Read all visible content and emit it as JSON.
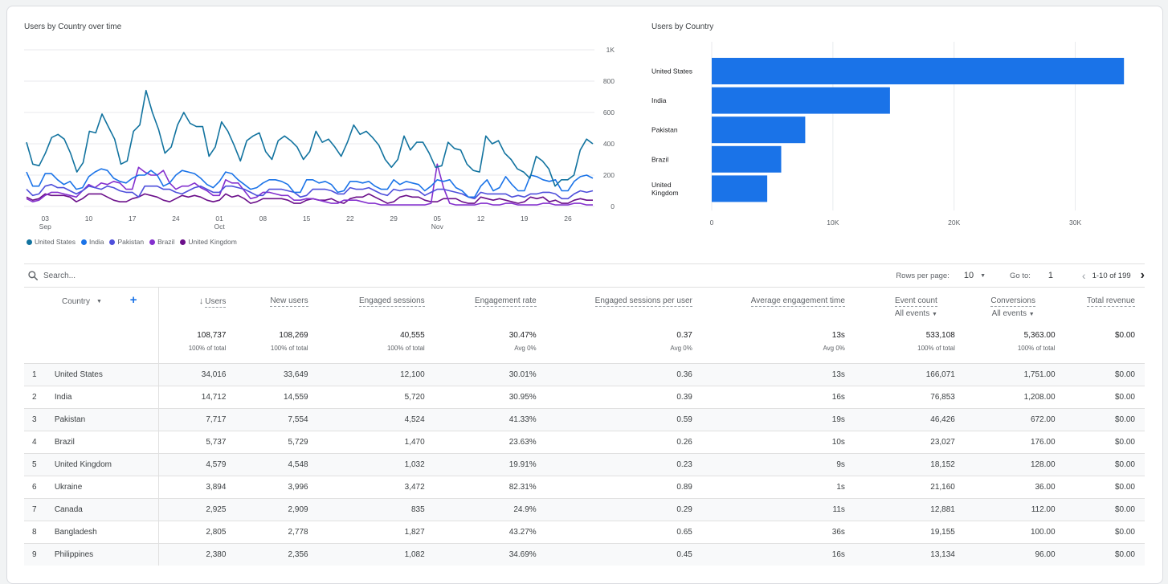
{
  "line_chart_title": "Users by Country over time",
  "bar_chart_title": "Users by Country",
  "chart_data": [
    {
      "type": "line",
      "title": "Users by Country over time",
      "xlabel": "",
      "ylabel": "",
      "ylim": [
        0,
        1000
      ],
      "y_ticks": [
        "0",
        "200",
        "400",
        "600",
        "800",
        "1K"
      ],
      "y_axis_side": "right",
      "x_ticks": [
        {
          "label": "03",
          "sub": "Sep",
          "day": 3
        },
        {
          "label": "10",
          "sub": "",
          "day": 10
        },
        {
          "label": "17",
          "sub": "",
          "day": 17
        },
        {
          "label": "24",
          "sub": "",
          "day": 24
        },
        {
          "label": "01",
          "sub": "Oct",
          "day": 31
        },
        {
          "label": "08",
          "sub": "",
          "day": 38
        },
        {
          "label": "15",
          "sub": "",
          "day": 45
        },
        {
          "label": "22",
          "sub": "",
          "day": 52
        },
        {
          "label": "29",
          "sub": "",
          "day": 59
        },
        {
          "label": "05",
          "sub": "Nov",
          "day": 66
        },
        {
          "label": "12",
          "sub": "",
          "day": 73
        },
        {
          "label": "19",
          "sub": "",
          "day": 80
        },
        {
          "label": "26",
          "sub": "",
          "day": 87
        }
      ],
      "x_start_day": 0,
      "x_end_day": 91,
      "grid": true,
      "legend_position": "bottom-left",
      "series": [
        {
          "name": "United States",
          "color": "#12739f",
          "values": [
            410,
            270,
            260,
            340,
            440,
            460,
            430,
            340,
            220,
            280,
            480,
            470,
            590,
            510,
            430,
            270,
            290,
            480,
            520,
            740,
            600,
            490,
            340,
            380,
            520,
            600,
            530,
            510,
            510,
            320,
            380,
            540,
            480,
            390,
            290,
            420,
            450,
            470,
            350,
            300,
            420,
            450,
            420,
            380,
            300,
            350,
            480,
            410,
            430,
            380,
            320,
            410,
            520,
            460,
            480,
            440,
            390,
            300,
            250,
            300,
            450,
            360,
            410,
            410,
            340,
            250,
            260,
            410,
            370,
            360,
            270,
            230,
            220,
            450,
            400,
            420,
            340,
            300,
            240,
            220,
            180,
            320,
            290,
            240,
            130,
            170,
            170,
            200,
            360,
            430,
            400
          ]
        },
        {
          "name": "India",
          "color": "#1a73e8",
          "values": [
            220,
            130,
            130,
            210,
            210,
            170,
            140,
            160,
            110,
            120,
            190,
            220,
            240,
            230,
            180,
            160,
            150,
            180,
            200,
            200,
            230,
            200,
            130,
            150,
            200,
            230,
            220,
            210,
            180,
            140,
            120,
            160,
            220,
            210,
            170,
            140,
            110,
            120,
            150,
            170,
            170,
            160,
            140,
            90,
            90,
            170,
            170,
            150,
            160,
            140,
            90,
            100,
            160,
            160,
            150,
            160,
            130,
            110,
            110,
            170,
            140,
            160,
            150,
            140,
            100,
            130,
            170,
            160,
            170,
            120,
            100,
            60,
            60,
            130,
            170,
            100,
            120,
            190,
            140,
            100,
            100,
            200,
            190,
            170,
            160,
            170,
            100,
            100,
            160,
            190,
            200,
            180
          ]
        },
        {
          "name": "Pakistan",
          "color": "#4e4fdb",
          "values": [
            110,
            70,
            80,
            130,
            140,
            120,
            120,
            100,
            80,
            100,
            130,
            120,
            110,
            130,
            120,
            100,
            90,
            90,
            60,
            130,
            130,
            130,
            110,
            110,
            90,
            80,
            100,
            120,
            130,
            110,
            90,
            90,
            130,
            130,
            120,
            110,
            90,
            70,
            70,
            110,
            110,
            110,
            100,
            90,
            60,
            70,
            110,
            110,
            110,
            100,
            80,
            80,
            120,
            110,
            110,
            120,
            100,
            80,
            70,
            110,
            100,
            110,
            110,
            100,
            70,
            90,
            110,
            110,
            100,
            90,
            80,
            60,
            50,
            90,
            80,
            80,
            80,
            80,
            60,
            70,
            60,
            80,
            80,
            90,
            90,
            80,
            50,
            50,
            80,
            100,
            90,
            100
          ]
        },
        {
          "name": "Brazil",
          "color": "#8430ce",
          "values": [
            50,
            30,
            40,
            70,
            90,
            90,
            80,
            70,
            60,
            100,
            140,
            120,
            150,
            140,
            160,
            150,
            110,
            110,
            250,
            220,
            200,
            200,
            230,
            150,
            110,
            130,
            130,
            150,
            120,
            100,
            70,
            70,
            170,
            150,
            150,
            100,
            50,
            60,
            90,
            90,
            80,
            70,
            70,
            40,
            40,
            50,
            50,
            40,
            30,
            20,
            20,
            40,
            40,
            40,
            30,
            20,
            20,
            10,
            10,
            10,
            10,
            10,
            10,
            10,
            10,
            20,
            270,
            120,
            20,
            10,
            10,
            10,
            10,
            20,
            20,
            10,
            10,
            20,
            20,
            10,
            10,
            10,
            10,
            20,
            20,
            10,
            10,
            10,
            20,
            20,
            10,
            10
          ]
        },
        {
          "name": "United Kingdom",
          "color": "#6b0f8a",
          "values": [
            60,
            40,
            50,
            80,
            70,
            70,
            70,
            60,
            30,
            50,
            80,
            80,
            80,
            60,
            40,
            30,
            30,
            50,
            60,
            80,
            70,
            60,
            40,
            30,
            50,
            70,
            60,
            70,
            60,
            40,
            30,
            40,
            80,
            60,
            70,
            50,
            20,
            30,
            50,
            50,
            50,
            50,
            40,
            20,
            20,
            40,
            50,
            40,
            40,
            50,
            30,
            20,
            50,
            60,
            60,
            80,
            60,
            40,
            20,
            30,
            60,
            70,
            60,
            60,
            40,
            30,
            30,
            50,
            50,
            50,
            30,
            20,
            20,
            60,
            50,
            40,
            50,
            40,
            30,
            20,
            30,
            60,
            50,
            60,
            30,
            40,
            20,
            20,
            40,
            50,
            40,
            40
          ]
        }
      ]
    },
    {
      "type": "bar",
      "orientation": "horizontal",
      "title": "Users by Country",
      "categories": [
        "United States",
        "India",
        "Pakistan",
        "Brazil",
        "United Kingdom"
      ],
      "category_lines": [
        [
          "United States"
        ],
        [
          "India"
        ],
        [
          "Pakistan"
        ],
        [
          "Brazil"
        ],
        [
          "United",
          "Kingdom"
        ]
      ],
      "values": [
        34016,
        14712,
        7717,
        5737,
        4579
      ],
      "color": "#1a73e8",
      "xlim": [
        0,
        35000
      ],
      "x_ticks": [
        {
          "value": 0,
          "label": "0"
        },
        {
          "value": 10000,
          "label": "10K"
        },
        {
          "value": 20000,
          "label": "20K"
        },
        {
          "value": 30000,
          "label": "30K"
        }
      ],
      "grid": true
    }
  ],
  "toolbar": {
    "search_placeholder": "Search...",
    "rows_per_page_label": "Rows per page:",
    "rows_per_page_value": "10",
    "goto_label": "Go to:",
    "goto_value": "1",
    "page_range": "1-10 of 199"
  },
  "table": {
    "dimension_header": "Country",
    "columns": [
      {
        "label": "Users",
        "sorted_desc": true,
        "sub": ""
      },
      {
        "label": "New users",
        "sub": ""
      },
      {
        "label": "Engaged sessions",
        "sub": ""
      },
      {
        "label": "Engagement rate",
        "sub": ""
      },
      {
        "label": "Engaged sessions per user",
        "sub": ""
      },
      {
        "label": "Average engagement time",
        "sub": ""
      },
      {
        "label": "Event count",
        "sub": "All events"
      },
      {
        "label": "Conversions",
        "sub": "All events"
      },
      {
        "label": "Total revenue",
        "sub": ""
      }
    ],
    "totals": [
      {
        "value": "108,737",
        "sub": "100% of total"
      },
      {
        "value": "108,269",
        "sub": "100% of total"
      },
      {
        "value": "40,555",
        "sub": "100% of total"
      },
      {
        "value": "30.47%",
        "sub": "Avg 0%"
      },
      {
        "value": "0.37",
        "sub": "Avg 0%"
      },
      {
        "value": "13s",
        "sub": "Avg 0%"
      },
      {
        "value": "533,108",
        "sub": "100% of total"
      },
      {
        "value": "5,363.00",
        "sub": "100% of total"
      },
      {
        "value": "$0.00",
        "sub": ""
      }
    ],
    "rows": [
      {
        "idx": "1",
        "country": "United States",
        "cells": [
          "34,016",
          "33,649",
          "12,100",
          "30.01%",
          "0.36",
          "13s",
          "166,071",
          "1,751.00",
          "$0.00"
        ]
      },
      {
        "idx": "2",
        "country": "India",
        "cells": [
          "14,712",
          "14,559",
          "5,720",
          "30.95%",
          "0.39",
          "16s",
          "76,853",
          "1,208.00",
          "$0.00"
        ]
      },
      {
        "idx": "3",
        "country": "Pakistan",
        "cells": [
          "7,717",
          "7,554",
          "4,524",
          "41.33%",
          "0.59",
          "19s",
          "46,426",
          "672.00",
          "$0.00"
        ]
      },
      {
        "idx": "4",
        "country": "Brazil",
        "cells": [
          "5,737",
          "5,729",
          "1,470",
          "23.63%",
          "0.26",
          "10s",
          "23,027",
          "176.00",
          "$0.00"
        ]
      },
      {
        "idx": "5",
        "country": "United Kingdom",
        "cells": [
          "4,579",
          "4,548",
          "1,032",
          "19.91%",
          "0.23",
          "9s",
          "18,152",
          "128.00",
          "$0.00"
        ]
      },
      {
        "idx": "6",
        "country": "Ukraine",
        "cells": [
          "3,894",
          "3,996",
          "3,472",
          "82.31%",
          "0.89",
          "1s",
          "21,160",
          "36.00",
          "$0.00"
        ]
      },
      {
        "idx": "7",
        "country": "Canada",
        "cells": [
          "2,925",
          "2,909",
          "835",
          "24.9%",
          "0.29",
          "11s",
          "12,881",
          "112.00",
          "$0.00"
        ]
      },
      {
        "idx": "8",
        "country": "Bangladesh",
        "cells": [
          "2,805",
          "2,778",
          "1,827",
          "43.27%",
          "0.65",
          "36s",
          "19,155",
          "100.00",
          "$0.00"
        ]
      },
      {
        "idx": "9",
        "country": "Philippines",
        "cells": [
          "2,380",
          "2,356",
          "1,082",
          "34.69%",
          "0.45",
          "16s",
          "13,134",
          "96.00",
          "$0.00"
        ]
      }
    ]
  },
  "colors": {
    "accent": "#1a73e8",
    "add_dimension_icon": "#1a73e8"
  }
}
